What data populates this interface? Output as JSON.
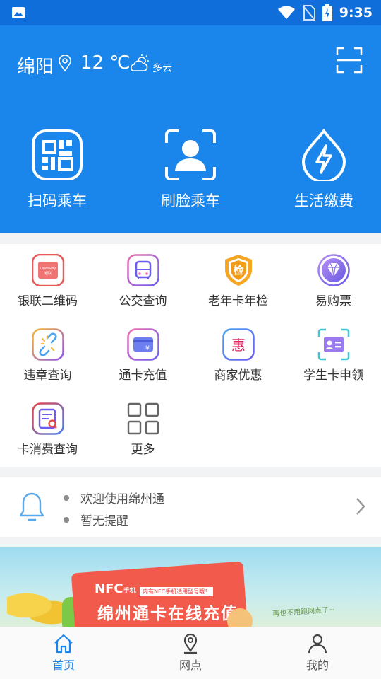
{
  "status_bar": {
    "time": "9:35"
  },
  "header": {
    "city": "绵阳",
    "temperature": "12 ℃",
    "weather": "多云"
  },
  "quick_actions": [
    {
      "label": "扫码乘车",
      "icon": "qr-code-icon"
    },
    {
      "label": "刷脸乘车",
      "icon": "face-scan-icon"
    },
    {
      "label": "生活缴费",
      "icon": "water-bolt-icon"
    }
  ],
  "services": [
    {
      "label": "银联二维码",
      "icon": "unionpay-card-icon"
    },
    {
      "label": "公交查询",
      "icon": "bus-icon"
    },
    {
      "label": "老年卡年检",
      "icon": "inspect-badge-icon",
      "glyph": "检"
    },
    {
      "label": "易购票",
      "icon": "diamond-icon"
    },
    {
      "label": "违章查询",
      "icon": "broken-link-icon"
    },
    {
      "label": "通卡充值",
      "icon": "card-recharge-icon"
    },
    {
      "label": "商家优惠",
      "icon": "discount-icon",
      "glyph": "惠"
    },
    {
      "label": "学生卡申领",
      "icon": "student-id-icon"
    },
    {
      "label": "卡消费查询",
      "icon": "bill-search-icon"
    },
    {
      "label": "更多",
      "icon": "more-grid-icon"
    }
  ],
  "notice": {
    "lines": [
      "欢迎使用绵州通",
      "暂无提醒"
    ]
  },
  "banner": {
    "badge": "NFC",
    "badge_suffix": "手机",
    "tag": "内有NFC手机适用型号哦！",
    "slogan": "绵州通卡在线充值",
    "handwriting": "再也不用跑网点了~"
  },
  "bottom_nav": [
    {
      "label": "首页",
      "icon": "home-icon",
      "active": true
    },
    {
      "label": "网点",
      "icon": "location-pin-icon",
      "active": false
    },
    {
      "label": "我的",
      "icon": "user-icon",
      "active": false
    }
  ],
  "colors": {
    "primary": "#1a86eb",
    "status_bar": "#0f6ed9",
    "nav_active": "#1a86eb"
  }
}
